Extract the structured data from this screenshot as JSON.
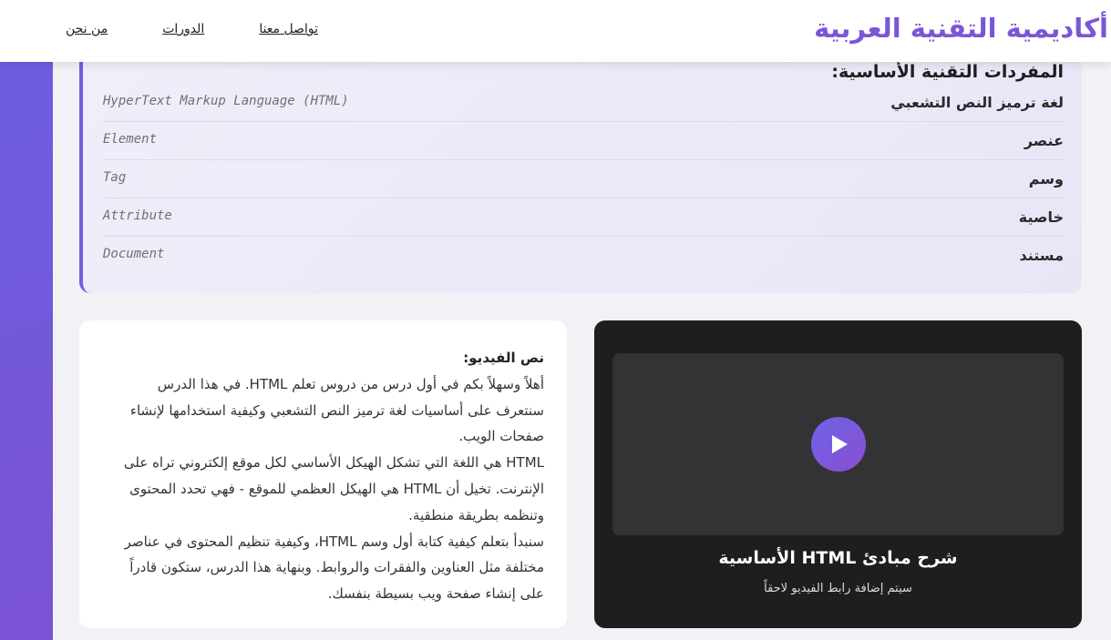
{
  "colors": {
    "brand": "#7b55d8",
    "accent": "#6f5fe0",
    "video_bg": "#1e1e1e",
    "play_button": "#7a5ae0"
  },
  "header": {
    "brand": "أكاديمية التقنية العربية",
    "nav": [
      {
        "label": "من نحن"
      },
      {
        "label": "الدورات"
      },
      {
        "label": "تواصل معنا"
      }
    ]
  },
  "vocabulary": {
    "title": "المفردات التقنية الأساسية:",
    "items": [
      {
        "ar": "لغة ترميز النص التشعبي",
        "en": "HyperText Markup Language (HTML)"
      },
      {
        "ar": "عنصر",
        "en": "Element"
      },
      {
        "ar": "وسم",
        "en": "Tag"
      },
      {
        "ar": "خاصية",
        "en": "Attribute"
      },
      {
        "ar": "مستند",
        "en": "Document"
      }
    ]
  },
  "transcript": {
    "title": "نص الفيديو:",
    "paragraphs": [
      "أهلاً وسهلاً بكم في أول درس من دروس تعلم HTML. في هذا الدرس سنتعرف على أساسيات لغة ترميز النص التشعبي وكيفية استخدامها لإنشاء صفحات الويب.",
      "HTML هي اللغة التي تشكل الهيكل الأساسي لكل موقع إلكتروني تراه على الإنترنت. تخيل أن HTML هي الهيكل العظمي للموقع - فهي تحدد المحتوى وتنظمه بطريقة منطقية.",
      "سنبدأ بتعلم كيفية كتابة أول وسم HTML، وكيفية تنظيم المحتوى في عناصر مختلفة مثل العناوين والفقرات والروابط. وبنهاية هذا الدرس، ستكون قادراً على إنشاء صفحة ويب بسيطة بنفسك."
    ]
  },
  "video": {
    "title": "شرح مبادئ HTML الأساسية",
    "note": "سيتم إضافة رابط الفيديو لاحقاً",
    "play_icon": "play-icon"
  }
}
